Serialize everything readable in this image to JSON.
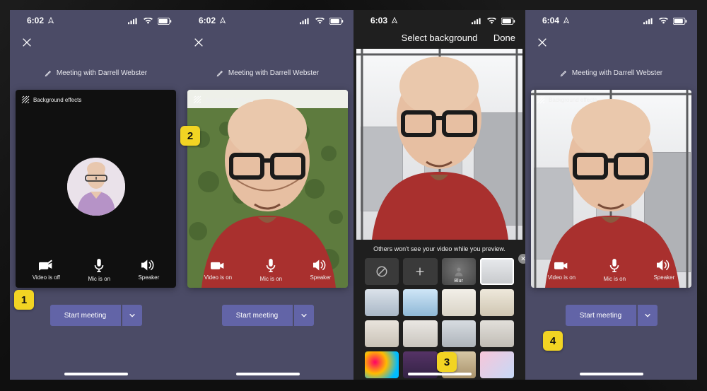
{
  "badges": {
    "b1": "1",
    "b2": "2",
    "b3": "3",
    "b4": "4"
  },
  "screens": [
    {
      "time": "6:02",
      "meeting_title": "Meeting with Darrell Webster",
      "bg_effects_label": "Background effects",
      "controls": {
        "video": "Video is off",
        "mic": "Mic is on",
        "audio": "Speaker"
      },
      "start_label": "Start meeting"
    },
    {
      "time": "6:02",
      "meeting_title": "Meeting with Darrell Webster",
      "bg_effects_label": "Background effects",
      "controls": {
        "video": "Video is on",
        "mic": "Mic is on",
        "audio": "Speaker"
      },
      "start_label": "Start meeting"
    },
    {
      "time": "6:03",
      "header_title": "Select background",
      "header_done": "Done",
      "preview_note": "Others won't see your video while you preview.",
      "tiles": {
        "blur_label": "Blur"
      }
    },
    {
      "time": "6:04",
      "meeting_title": "Meeting with Darrell Webster",
      "bg_effects_label": "Background effects",
      "controls": {
        "video": "Video is on",
        "mic": "Mic is on",
        "audio": "Speaker"
      },
      "start_label": "Start meeting"
    }
  ]
}
